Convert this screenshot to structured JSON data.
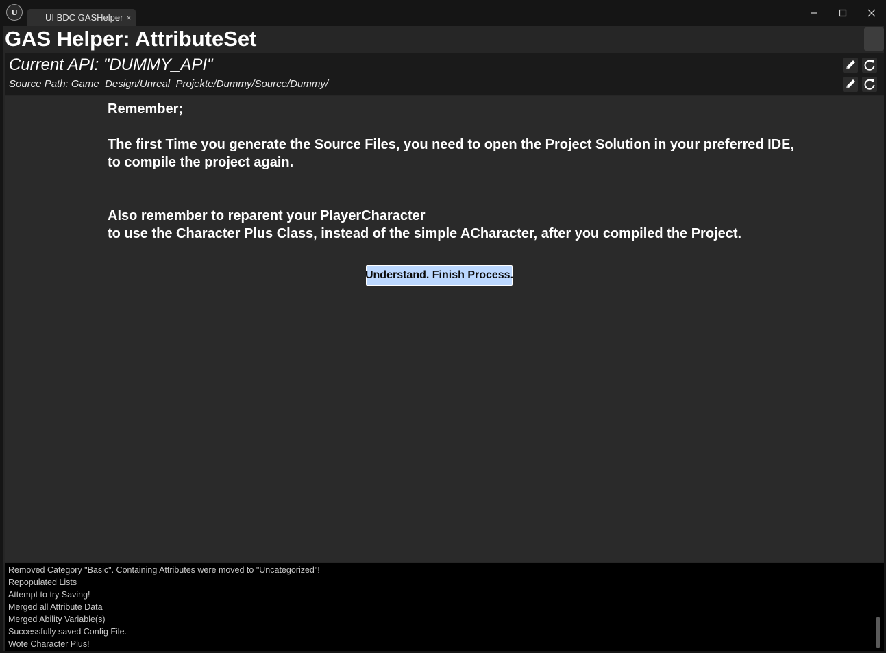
{
  "window": {
    "tab_title": "UI BDC GASHelper",
    "tab_close": "×",
    "logo_text": "U",
    "controls": {
      "minimize": "—",
      "maximize": "☐",
      "close": "✕"
    }
  },
  "header": {
    "title": "GAS Helper: AttributeSet"
  },
  "api_panel": {
    "current_api": "Current API: \"DUMMY_API\"",
    "source_path": "Source Path: Game_Design/Unreal_Projekte/Dummy/Source/Dummy/"
  },
  "main": {
    "line1": "Remember;",
    "line2": "The first Time you generate the Source Files, you need to open the Project Solution in your preferred IDE,",
    "line3": "to compile the project again.",
    "line4": "Also remember to reparent your PlayerCharacter",
    "line5": "to use the Character Plus Class, instead of the simple ACharacter, after you compiled the Project.",
    "button_label": "Understand. Finish Process."
  },
  "log": {
    "lines": [
      "Removed Category \"Basic\". Containing Attributes were moved to \"Uncategorized\"!",
      "Repopulated Lists",
      "Attempt to try Saving!",
      "Merged all Attribute Data",
      "Merged Ability Variable(s)",
      "Successfully saved Config File.",
      "Wote Character Plus!"
    ]
  },
  "icons": {
    "edit": "pencil-icon",
    "refresh": "refresh-icon"
  },
  "colors": {
    "button_bg": "#bcd8ff",
    "panel_bg": "#2a2a2a",
    "log_bg": "#000000"
  }
}
